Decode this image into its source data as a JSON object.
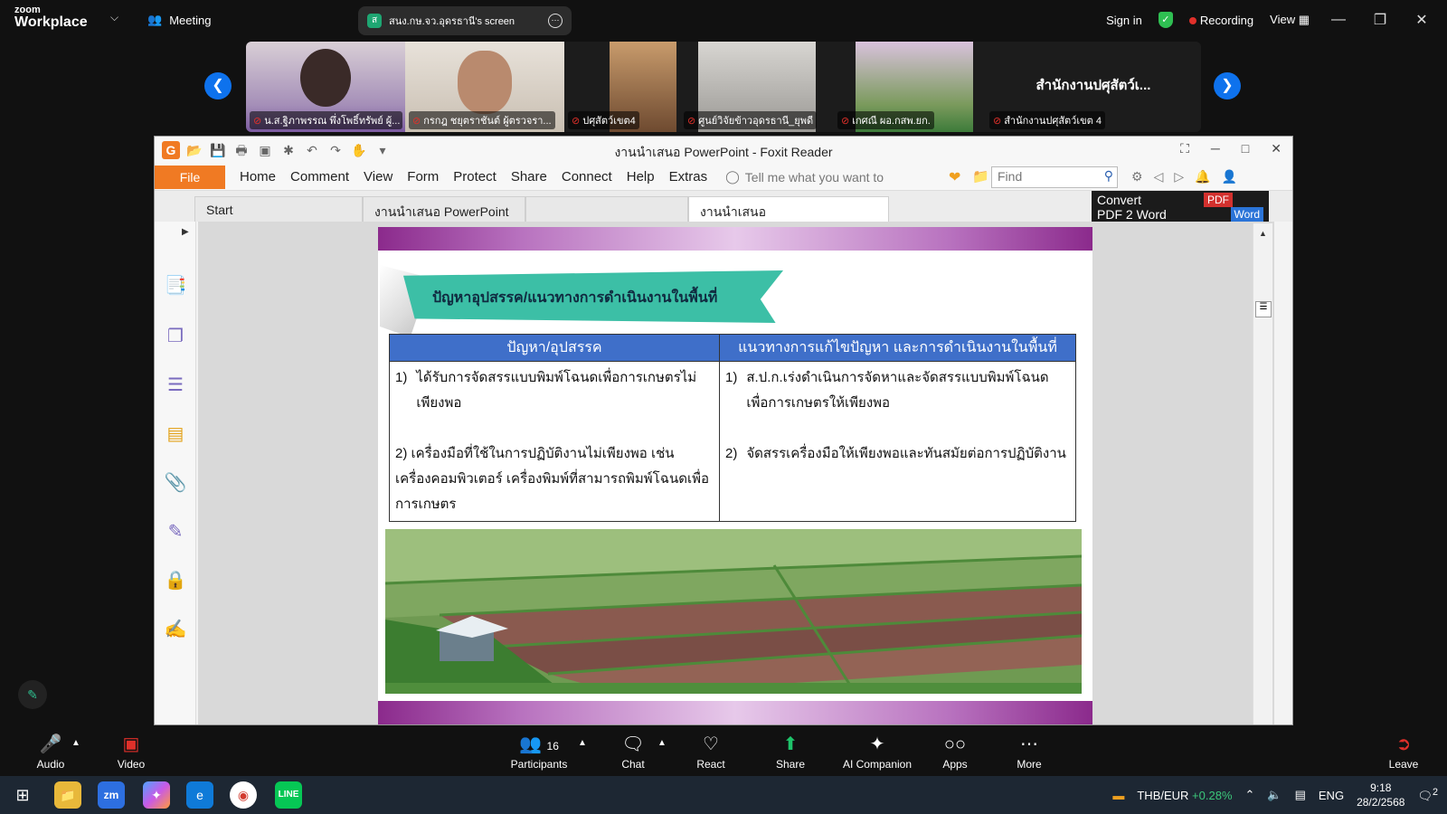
{
  "zoom": {
    "logo_line1": "zoom",
    "logo_line2": "Workplace",
    "meeting_label": "Meeting",
    "screen_share_label": "สนง.กษ.จว.อุดรธานี's screen",
    "screen_share_badge": "ส",
    "sign_in": "Sign in",
    "recording": "Recording",
    "view": "View"
  },
  "participants": [
    {
      "name": "น.ส.ฐิภาพรรณ พึ่งโพธิ์ทรัพย์ ผู้..."
    },
    {
      "name": "กรกฎ ชยุตราชันต์ ผู้ตรวจรา..."
    },
    {
      "name": "ปศุสัตว์เขต4"
    },
    {
      "name": "ศูนย์วิจัยข้าวอุดรธานี_ยุพดี"
    },
    {
      "name": "เกศณี ผอ.กสพ.ยก."
    },
    {
      "name": "สำนักงานปศุสัตว์เขต 4",
      "title": "สำนักงานปศุสัตว์เ..."
    }
  ],
  "foxit": {
    "title": "งานนำเสนอ PowerPoint - Foxit Reader",
    "menu": [
      "Home",
      "Comment",
      "View",
      "Form",
      "Protect",
      "Share",
      "Connect",
      "Help",
      "Extras"
    ],
    "file": "File",
    "tell_me": "Tell me what you want to",
    "find_placeholder": "Find",
    "tabs": [
      "Start",
      "งานนำเสนอ PowerPoint",
      "งานนำเสนอ PowerPoint"
    ],
    "convert_line1": "Convert",
    "convert_line2": "PDF 2 Word",
    "convert_pdf": "PDF",
    "convert_word": "Word"
  },
  "slide": {
    "heading": "ปัญหาอุปสรรค/แนวทางการดำเนินงานในพื้นที่",
    "col1_header": "ปัญหา/อุปสรรค",
    "col2_header": "แนวทางการแก้ไขปัญหา และการดำเนินงานในพื้นที่",
    "col1_item1_num": "1)",
    "col1_item1": "ได้รับการจัดสรรแบบพิมพ์โฉนดเพื่อการเกษตรไม่เพียงพอ",
    "col1_item2": "2) เครื่องมือที่ใช้ในการปฏิบัติงานไม่เพียงพอ เช่น เครื่องคอมพิวเตอร์ เครื่องพิมพ์ที่สามารถพิมพ์โฉนดเพื่อการเกษตร",
    "col2_item1_num": "1)",
    "col2_item1": "ส.ป.ก.เร่งดำเนินการจัดหาและจัดสรรแบบพิมพ์โฉนดเพื่อการเกษตรให้เพียงพอ",
    "col2_item2_num": "2)",
    "col2_item2": "จัดสรรเครื่องมือให้เพียงพอและทันสมัยต่อการปฏิบัติงาน"
  },
  "toolbar": {
    "audio": "Audio",
    "video": "Video",
    "participants": "Participants",
    "participants_count": "16",
    "chat": "Chat",
    "react": "React",
    "share": "Share",
    "ai_companion": "AI Companion",
    "apps": "Apps",
    "more": "More",
    "leave": "Leave"
  },
  "taskbar": {
    "currency": "THB/EUR",
    "currency_change": "+0.28%",
    "lang": "ENG",
    "time": "9:18",
    "date": "28/2/2568",
    "notif": "2"
  }
}
